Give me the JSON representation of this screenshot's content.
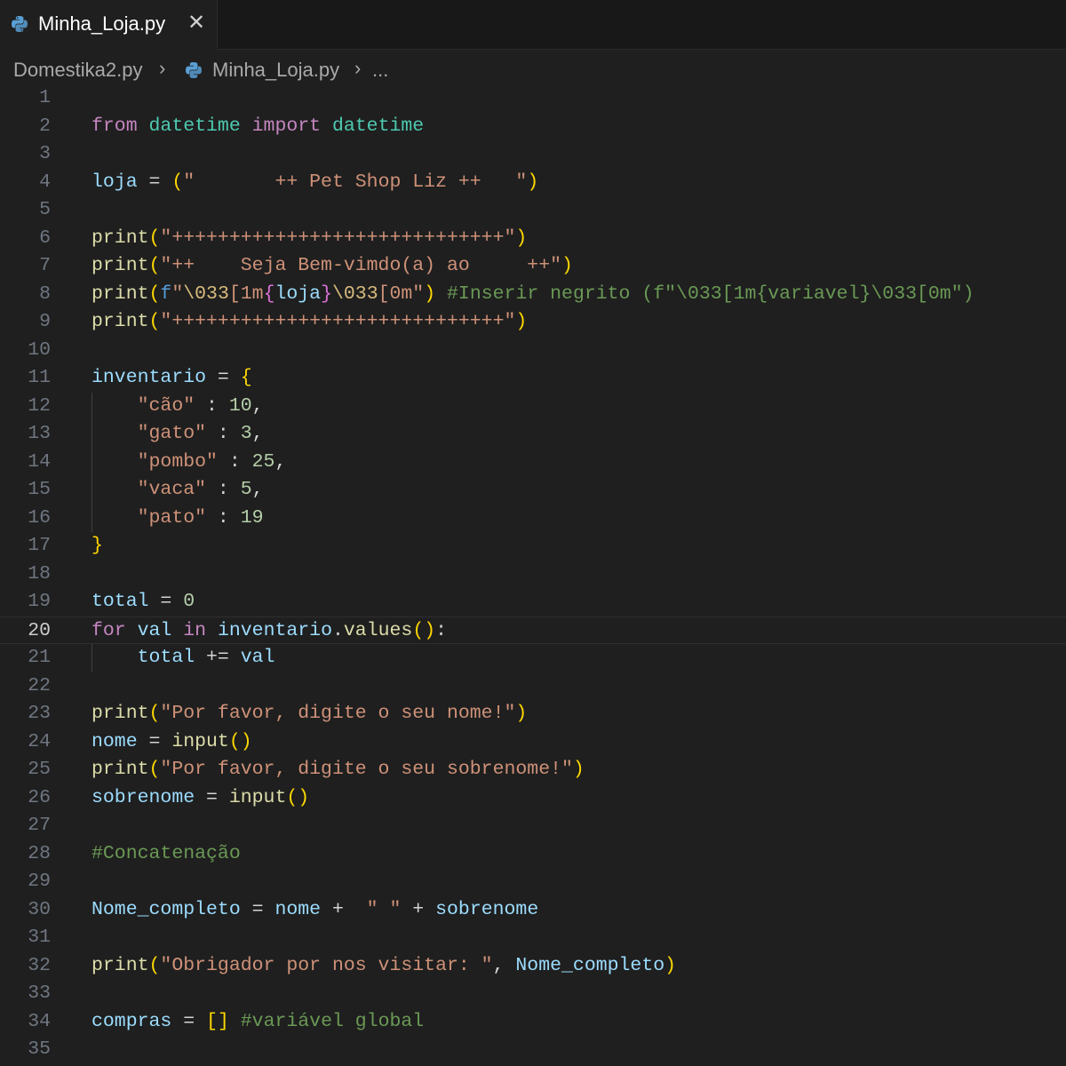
{
  "tab": {
    "title": "Minha_Loja.py",
    "close_label": "✕",
    "icon": "python-file-icon"
  },
  "breadcrumb": {
    "items": [
      "Domestika2.py",
      "Minha_Loja.py",
      "..."
    ],
    "separator": "›"
  },
  "editor": {
    "language": "python",
    "current_line": 20,
    "lines": [
      {
        "n": "1",
        "tokens": []
      },
      {
        "n": "2",
        "tokens": [
          [
            "kw",
            "from"
          ],
          [
            "op",
            " "
          ],
          [
            "mod",
            "datetime"
          ],
          [
            "op",
            " "
          ],
          [
            "kw",
            "import"
          ],
          [
            "op",
            " "
          ],
          [
            "mod",
            "datetime"
          ]
        ]
      },
      {
        "n": "3",
        "tokens": []
      },
      {
        "n": "4",
        "tokens": [
          [
            "var",
            "loja"
          ],
          [
            "op",
            " = "
          ],
          [
            "br1",
            "("
          ],
          [
            "str",
            "\"       ++ Pet Shop Liz ++   \""
          ],
          [
            "br1",
            ")"
          ]
        ]
      },
      {
        "n": "5",
        "tokens": []
      },
      {
        "n": "6",
        "tokens": [
          [
            "fn",
            "print"
          ],
          [
            "br1",
            "("
          ],
          [
            "str",
            "\"+++++++++++++++++++++++++++++\""
          ],
          [
            "br1",
            ")"
          ]
        ]
      },
      {
        "n": "7",
        "tokens": [
          [
            "fn",
            "print"
          ],
          [
            "br1",
            "("
          ],
          [
            "str",
            "\"++    Seja Bem-vimdo(a) ao     ++\""
          ],
          [
            "br1",
            ")"
          ]
        ]
      },
      {
        "n": "8",
        "tokens": [
          [
            "fn",
            "print"
          ],
          [
            "br1",
            "("
          ],
          [
            "fpre",
            "f"
          ],
          [
            "str",
            "\""
          ],
          [
            "esc",
            "\\033"
          ],
          [
            "str",
            "[1m"
          ],
          [
            "br2",
            "{"
          ],
          [
            "var",
            "loja"
          ],
          [
            "br2",
            "}"
          ],
          [
            "esc",
            "\\033"
          ],
          [
            "str",
            "[0m\""
          ],
          [
            "br1",
            ")"
          ],
          [
            "op",
            " "
          ],
          [
            "cmt",
            "#Inserir negrito (f\"\\033[1m{variavel}\\033[0m\")"
          ]
        ]
      },
      {
        "n": "9",
        "tokens": [
          [
            "fn",
            "print"
          ],
          [
            "br1",
            "("
          ],
          [
            "str",
            "\"+++++++++++++++++++++++++++++\""
          ],
          [
            "br1",
            ")"
          ]
        ]
      },
      {
        "n": "10",
        "tokens": []
      },
      {
        "n": "11",
        "tokens": [
          [
            "var",
            "inventario"
          ],
          [
            "op",
            " = "
          ],
          [
            "br1",
            "{"
          ]
        ]
      },
      {
        "n": "12",
        "tokens": [
          [
            "op",
            "    "
          ],
          [
            "str",
            "\"cão\""
          ],
          [
            "op",
            " : "
          ],
          [
            "num",
            "10"
          ],
          [
            "op",
            ","
          ]
        ]
      },
      {
        "n": "13",
        "tokens": [
          [
            "op",
            "    "
          ],
          [
            "str",
            "\"gato\""
          ],
          [
            "op",
            " : "
          ],
          [
            "num",
            "3"
          ],
          [
            "op",
            ","
          ]
        ]
      },
      {
        "n": "14",
        "tokens": [
          [
            "op",
            "    "
          ],
          [
            "str",
            "\"pombo\""
          ],
          [
            "op",
            " : "
          ],
          [
            "num",
            "25"
          ],
          [
            "op",
            ","
          ]
        ]
      },
      {
        "n": "15",
        "tokens": [
          [
            "op",
            "    "
          ],
          [
            "str",
            "\"vaca\""
          ],
          [
            "op",
            " : "
          ],
          [
            "num",
            "5"
          ],
          [
            "op",
            ","
          ]
        ]
      },
      {
        "n": "16",
        "tokens": [
          [
            "op",
            "    "
          ],
          [
            "str",
            "\"pato\""
          ],
          [
            "op",
            " : "
          ],
          [
            "num",
            "19"
          ]
        ]
      },
      {
        "n": "17",
        "tokens": [
          [
            "br1",
            "}"
          ]
        ]
      },
      {
        "n": "18",
        "tokens": []
      },
      {
        "n": "19",
        "tokens": [
          [
            "var",
            "total"
          ],
          [
            "op",
            " = "
          ],
          [
            "num",
            "0"
          ]
        ]
      },
      {
        "n": "20",
        "tokens": [
          [
            "ctl",
            "for"
          ],
          [
            "op",
            " "
          ],
          [
            "var",
            "val"
          ],
          [
            "op",
            " "
          ],
          [
            "ctl",
            "in"
          ],
          [
            "op",
            " "
          ],
          [
            "var",
            "inventario"
          ],
          [
            "op",
            "."
          ],
          [
            "fn",
            "values"
          ],
          [
            "br1",
            "()"
          ],
          [
            "op",
            ":"
          ]
        ]
      },
      {
        "n": "21",
        "tokens": [
          [
            "op",
            "    "
          ],
          [
            "var",
            "total"
          ],
          [
            "op",
            " += "
          ],
          [
            "var",
            "val"
          ]
        ]
      },
      {
        "n": "22",
        "tokens": []
      },
      {
        "n": "23",
        "tokens": [
          [
            "fn",
            "print"
          ],
          [
            "br1",
            "("
          ],
          [
            "str",
            "\"Por favor, digite o seu nome!\""
          ],
          [
            "br1",
            ")"
          ]
        ]
      },
      {
        "n": "24",
        "tokens": [
          [
            "var",
            "nome"
          ],
          [
            "op",
            " = "
          ],
          [
            "fn",
            "input"
          ],
          [
            "br1",
            "()"
          ]
        ]
      },
      {
        "n": "25",
        "tokens": [
          [
            "fn",
            "print"
          ],
          [
            "br1",
            "("
          ],
          [
            "str",
            "\"Por favor, digite o seu sobrenome!\""
          ],
          [
            "br1",
            ")"
          ]
        ]
      },
      {
        "n": "26",
        "tokens": [
          [
            "var",
            "sobrenome"
          ],
          [
            "op",
            " = "
          ],
          [
            "fn",
            "input"
          ],
          [
            "br1",
            "()"
          ]
        ]
      },
      {
        "n": "27",
        "tokens": []
      },
      {
        "n": "28",
        "tokens": [
          [
            "cmt",
            "#Concatenação"
          ]
        ]
      },
      {
        "n": "29",
        "tokens": []
      },
      {
        "n": "30",
        "tokens": [
          [
            "var",
            "Nome_completo"
          ],
          [
            "op",
            " = "
          ],
          [
            "var",
            "nome"
          ],
          [
            "op",
            " +  "
          ],
          [
            "str",
            "\" \""
          ],
          [
            "op",
            " + "
          ],
          [
            "var",
            "sobrenome"
          ]
        ]
      },
      {
        "n": "31",
        "tokens": []
      },
      {
        "n": "32",
        "tokens": [
          [
            "fn",
            "print"
          ],
          [
            "br1",
            "("
          ],
          [
            "str",
            "\"Obrigador por nos visitar: \""
          ],
          [
            "op",
            ", "
          ],
          [
            "var",
            "Nome_completo"
          ],
          [
            "br1",
            ")"
          ]
        ]
      },
      {
        "n": "33",
        "tokens": []
      },
      {
        "n": "34",
        "tokens": [
          [
            "var",
            "compras"
          ],
          [
            "op",
            " = "
          ],
          [
            "br1",
            "[]"
          ],
          [
            "op",
            " "
          ],
          [
            "cmt",
            "#variável global"
          ]
        ]
      },
      {
        "n": "35",
        "tokens": []
      }
    ]
  }
}
